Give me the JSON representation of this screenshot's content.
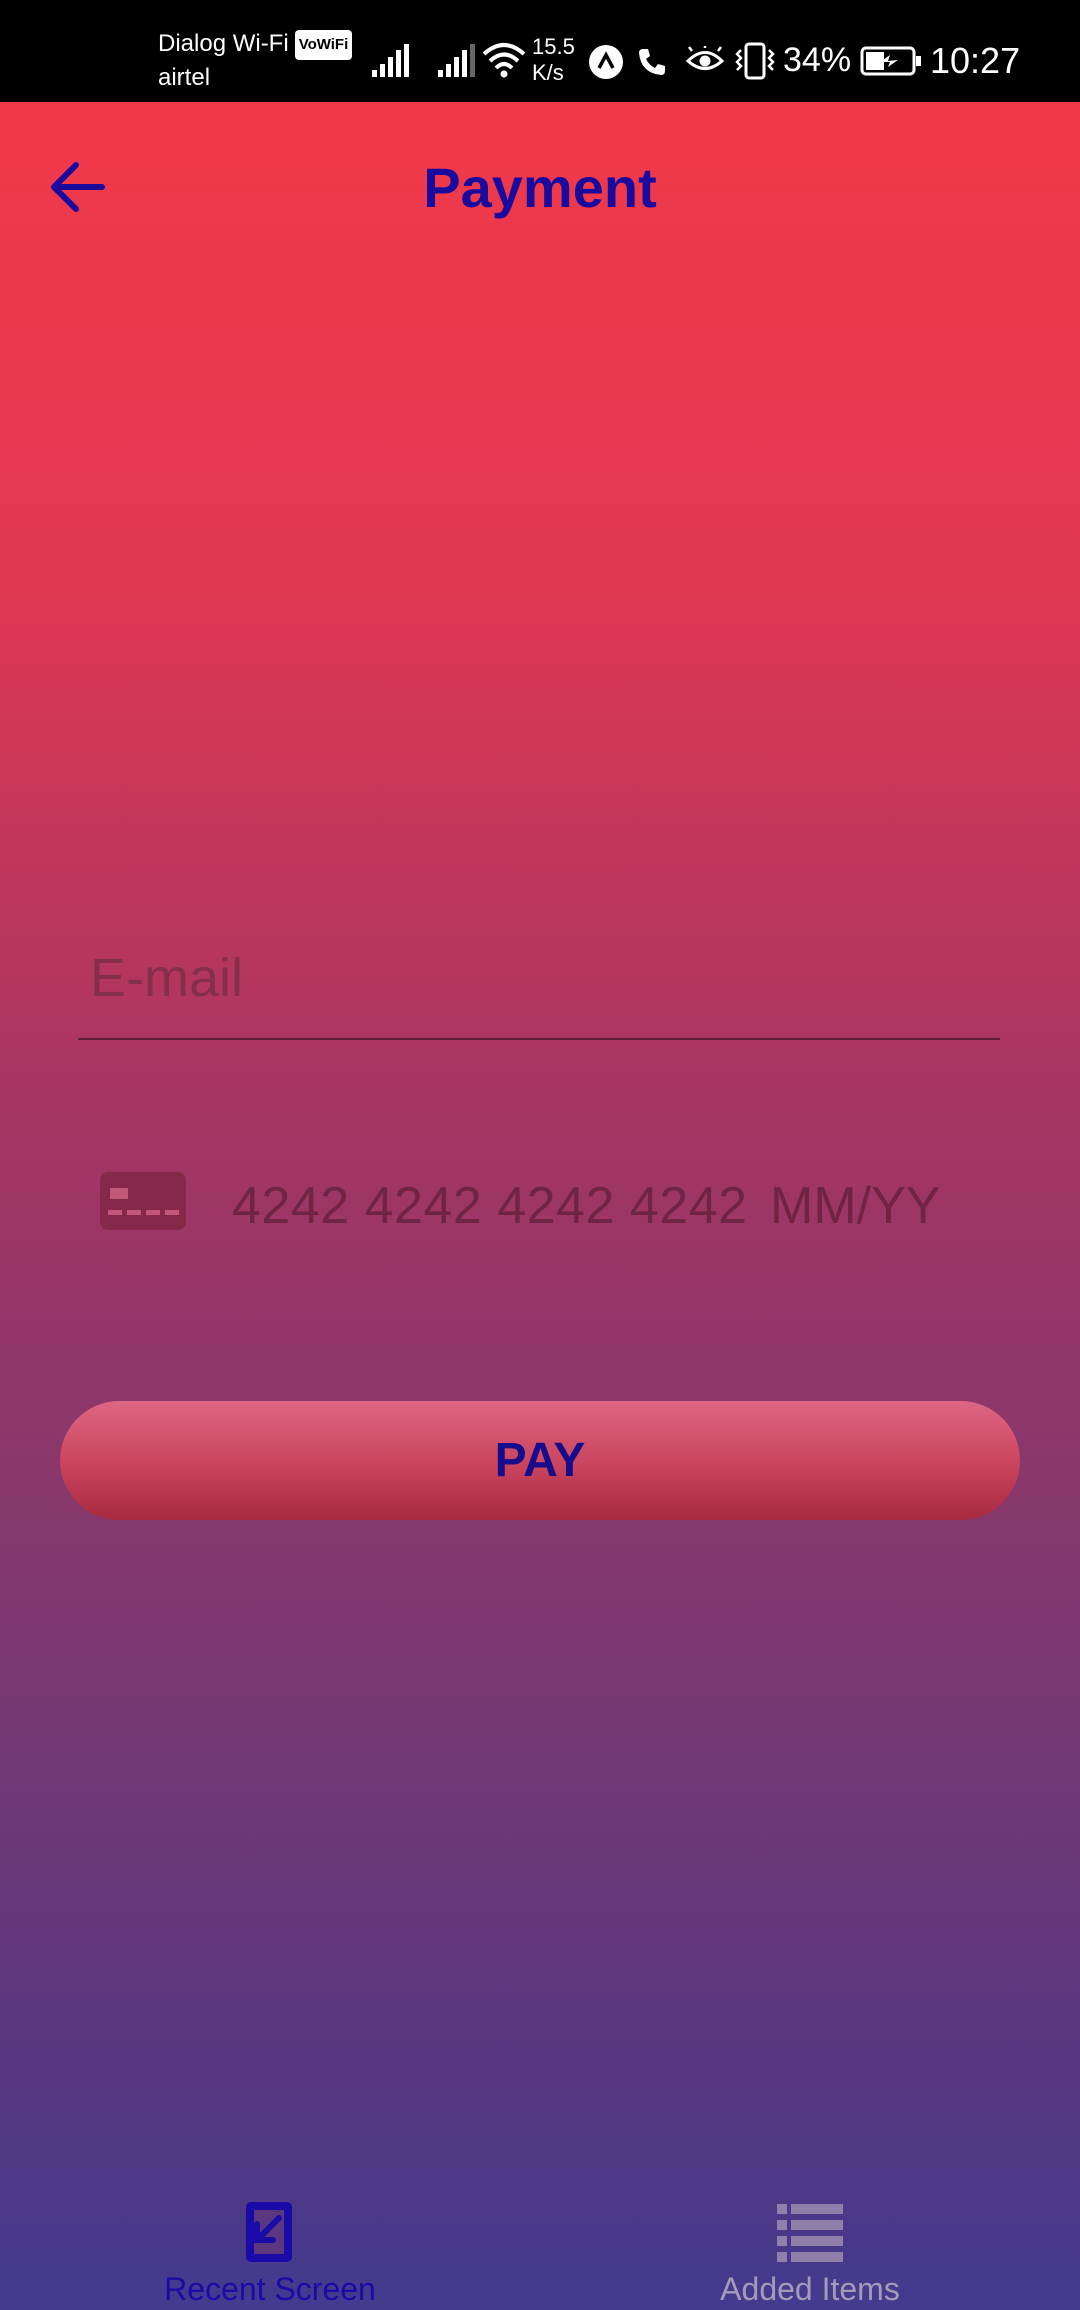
{
  "status_bar": {
    "carrier_primary": "Dialog Wi-Fi",
    "vowifi_badge": "VoWiFi",
    "carrier_secondary": "airtel",
    "net_speed_value": "15.5",
    "net_speed_unit": "K/s",
    "battery_percent": "34%",
    "time": "10:27",
    "icons": [
      "signal-icon",
      "signal-icon",
      "wifi-icon",
      "nav-app-icon",
      "phone-icon",
      "eye-icon",
      "vibrate-icon",
      "battery-icon"
    ]
  },
  "header": {
    "title": "Payment",
    "back_icon": "arrow-left-icon"
  },
  "form": {
    "email_placeholder": "E-mail",
    "email_value": "",
    "card_number_placeholder": "4242 4242 4242 4242",
    "card_expiry_placeholder": "MM/YY",
    "card_icon": "credit-card-icon"
  },
  "pay_button": {
    "label": "PAY"
  },
  "bottom_nav": {
    "items": [
      {
        "label": "Recent Screen",
        "icon": "recent-screen-icon",
        "active": true
      },
      {
        "label": "Added Items",
        "icon": "list-icon",
        "active": false
      }
    ]
  },
  "colors": {
    "gradient_top": "#f53947",
    "gradient_bottom": "#433a8e",
    "accent": "#1a0a9e",
    "pay_button": "#c9435d",
    "inactive_nav": "#a59ab7"
  }
}
